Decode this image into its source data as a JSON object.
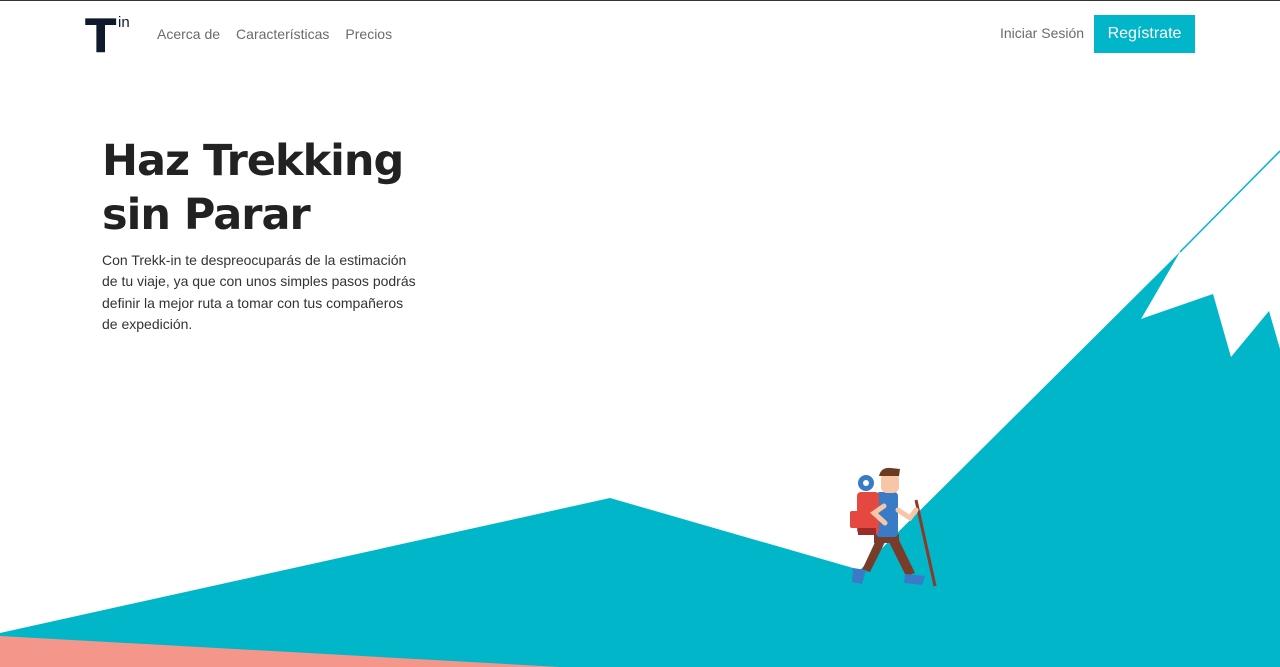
{
  "brand": {
    "logo_letter": "T",
    "logo_suffix": "in"
  },
  "nav": {
    "links": [
      "Acerca de",
      "Características",
      "Precios"
    ],
    "login_label": "Iniciar Sesión",
    "signup_label": "Regístrate"
  },
  "hero": {
    "title_line1": "Haz Trekking",
    "title_line2": "sin Parar",
    "description": "Con Trekk-in te despreocuparás de la estimación de tu viaje, ya que con unos simples pasos podrás definir la mejor ruta a tomar con tus compañeros de expedición."
  },
  "colors": {
    "accent": "#00b6c8",
    "mountain": "#00b6c8",
    "ground_salmon": "#f4978a",
    "logo_dark": "#0f1b2d",
    "title": "#222222"
  }
}
